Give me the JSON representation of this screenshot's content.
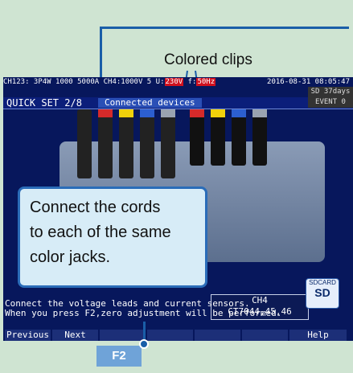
{
  "clip_label": "Colored clips",
  "callout_text_lines": [
    "Connect the cords",
    "to each of the same",
    "color jacks."
  ],
  "status": {
    "line1_left": "CH123:  3P4W  1000   5000A   CH4:1000V 5",
    "line1_hl_u": "U:",
    "line1_u": "230V",
    "line1_f": "f:",
    "line1_freq": "50Hz",
    "line1_right": "2016-08-31 08:05:47"
  },
  "header": {
    "title": "QUICK SET 2/8",
    "tab": "Connected devices",
    "sd": "SD",
    "sd_days": "37days",
    "event": "EVENT",
    "event_count": "0"
  },
  "channel_box": {
    "label": "CH4",
    "model": "CT7044,45,46"
  },
  "sd_card": {
    "label": "SDCARD",
    "symbol": "SD"
  },
  "message_lines": [
    "Connect the voltage leads and current sensors.",
    "When you press F2,zero adjustment will be performed."
  ],
  "fkeys": [
    "Previous",
    "Next",
    "",
    "",
    "",
    "",
    "Help"
  ],
  "f2_key": "F2",
  "colors": {
    "accent": "#1a5ea8",
    "screen_bg": "#07175c",
    "page_bg": "#cfe4d2"
  }
}
